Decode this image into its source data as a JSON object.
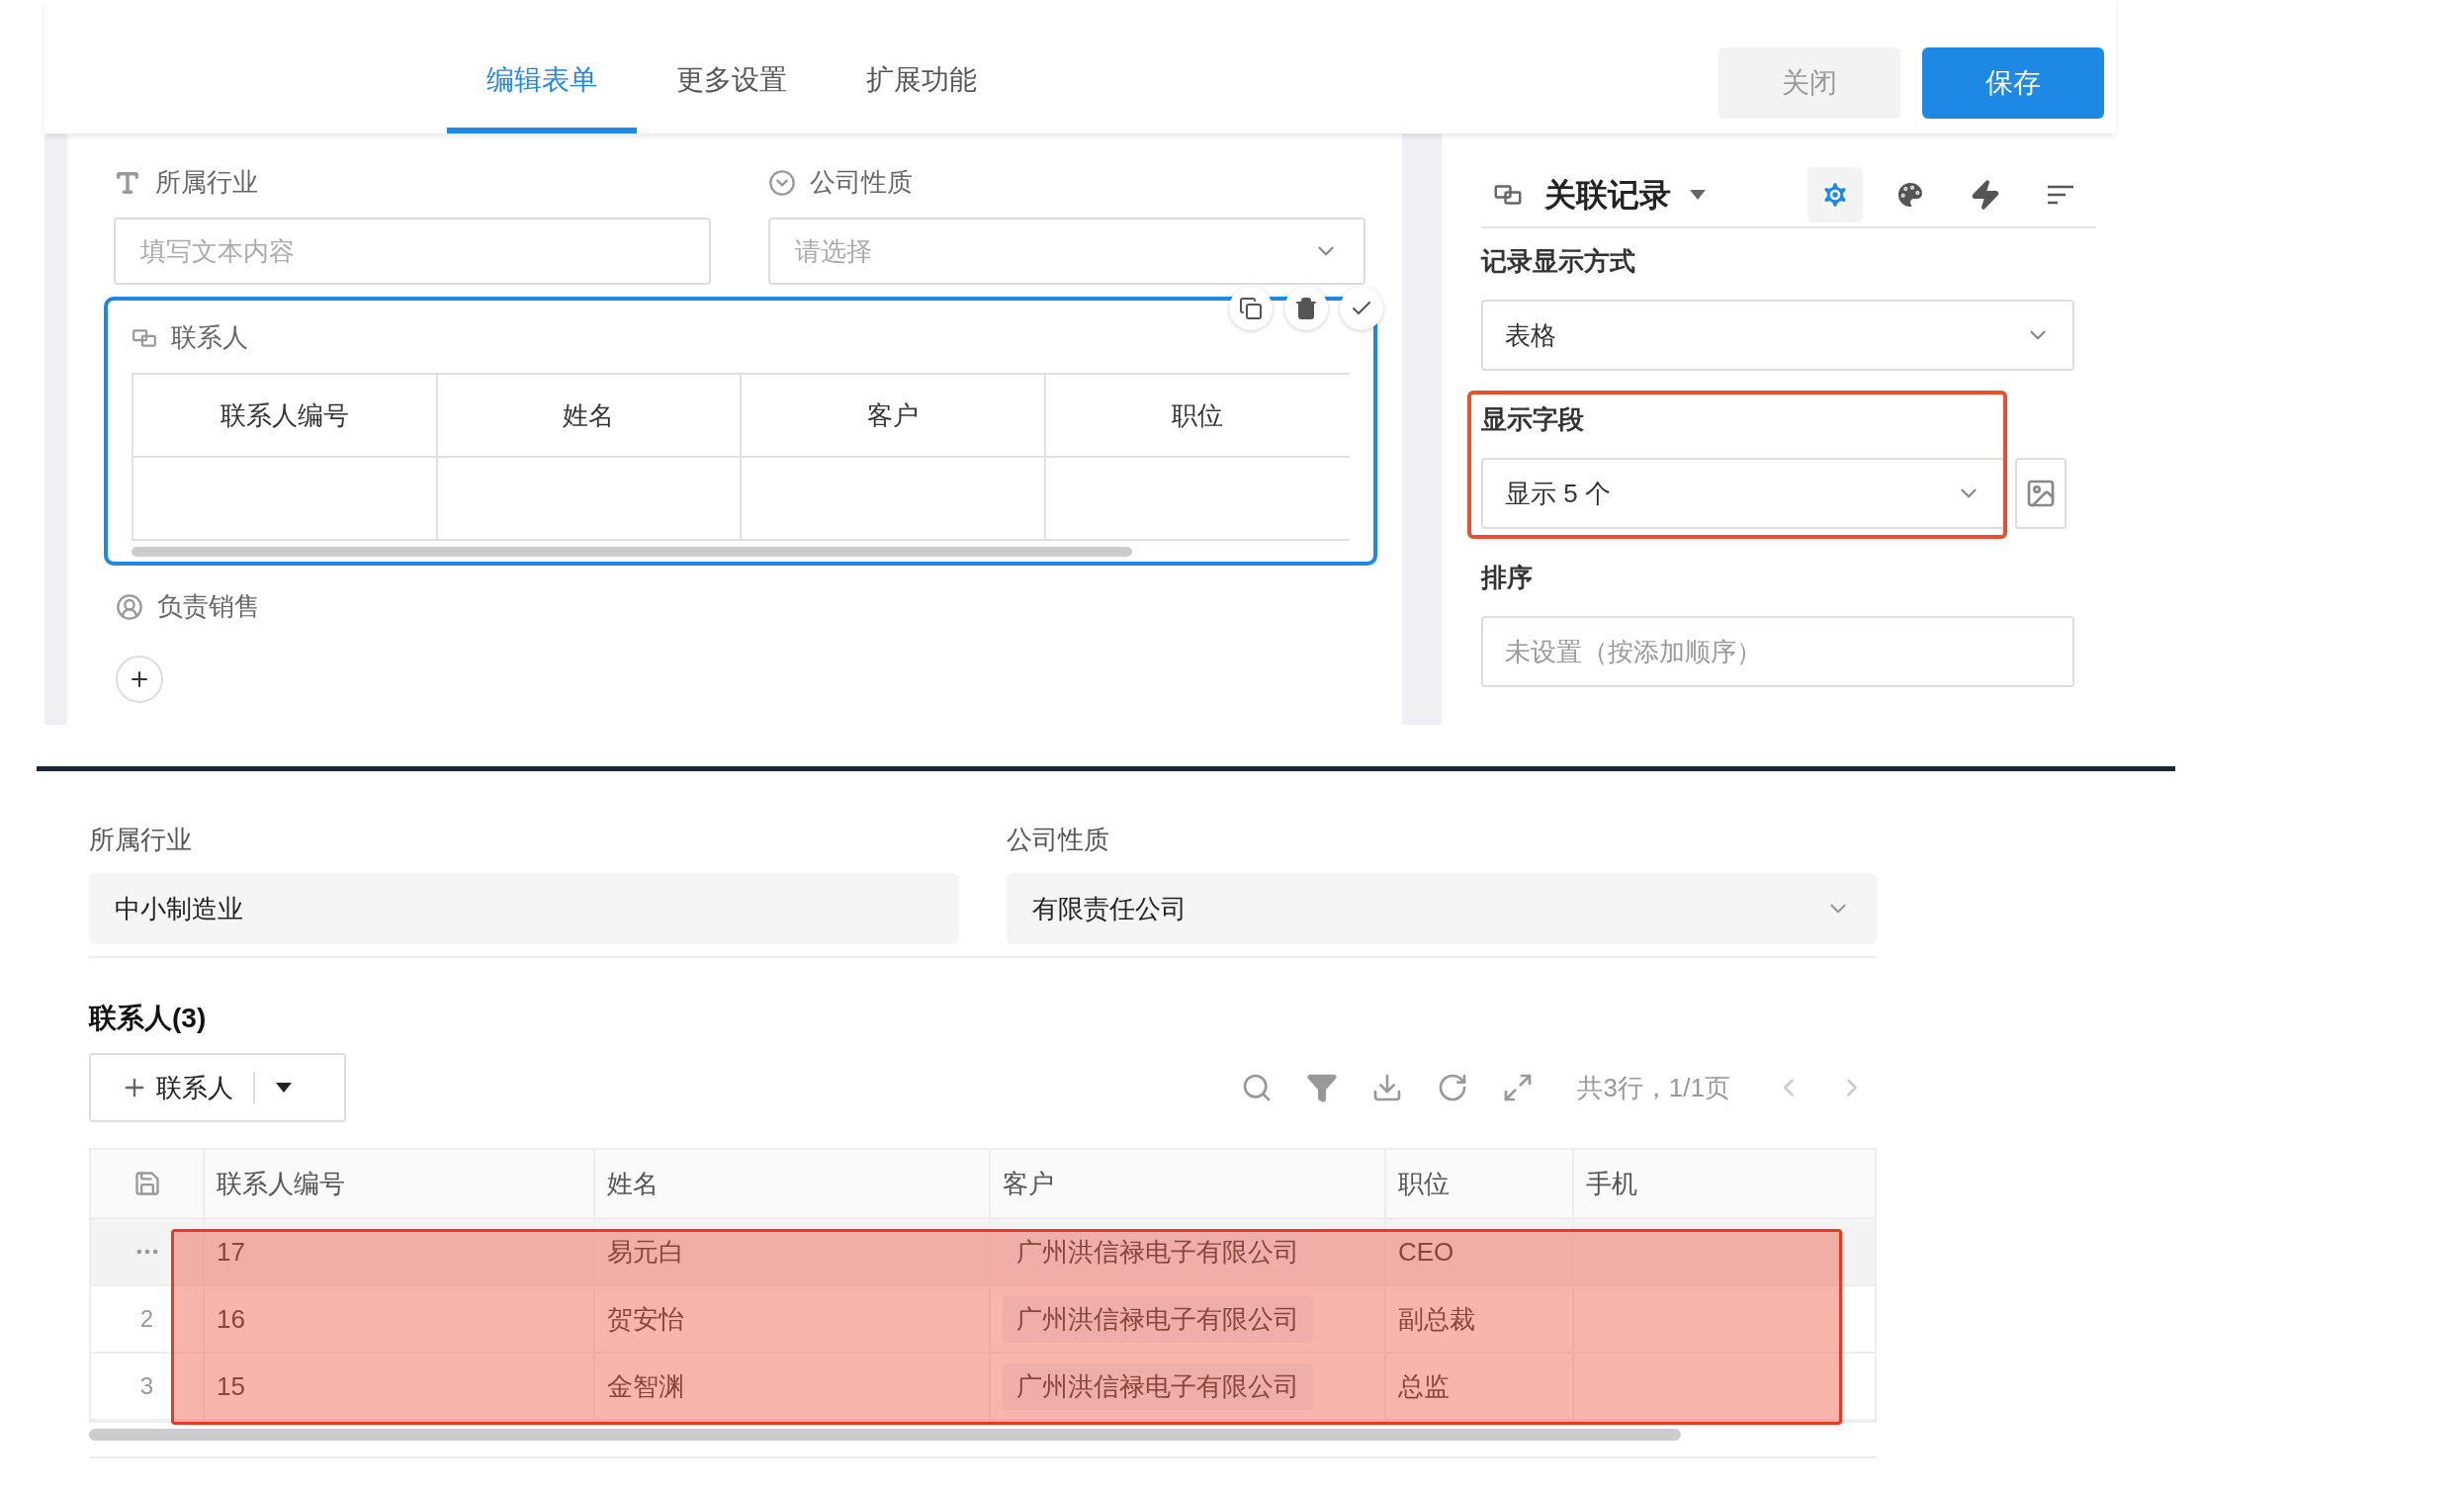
{
  "tabs": [
    {
      "label": "编辑表单",
      "selected": true
    },
    {
      "label": "更多设置",
      "selected": false
    },
    {
      "label": "扩展功能",
      "selected": false
    }
  ],
  "header_buttons": [
    {
      "label": "关闭",
      "kind": "secondary"
    },
    {
      "label": "保存",
      "kind": "primary"
    }
  ],
  "form_canvas": {
    "fields": [
      {
        "kind": "text",
        "label": "所属行业",
        "placeholder": "填写文本内容"
      },
      {
        "kind": "select",
        "label": "公司性质",
        "placeholder": "请选择"
      }
    ],
    "relation_field": {
      "label": "联系人",
      "selected": true,
      "columns": [
        "联系人编号",
        "姓名",
        "客户",
        "职位"
      ]
    },
    "user_field": {
      "label": "负责销售"
    }
  },
  "settings_panel": {
    "title": "关联记录",
    "tools": [
      {
        "kind": "settings",
        "selected": true
      },
      {
        "kind": "style",
        "selected": false
      },
      {
        "kind": "action",
        "selected": false
      },
      {
        "kind": "sort",
        "selected": false
      }
    ],
    "sections": [
      {
        "kind": "select",
        "label": "记录显示方式",
        "value": "表格"
      },
      {
        "kind": "select_image",
        "label": "显示字段",
        "value": "显示 5 个",
        "highlighted": true
      },
      {
        "kind": "text",
        "label": "排序",
        "placeholder": "未设置（按添加顺序）"
      }
    ]
  },
  "preview": {
    "fields": [
      {
        "kind": "text",
        "label": "所属行业",
        "value": "中小制造业"
      },
      {
        "kind": "select",
        "label": "公司性质",
        "value": "有限责任公司"
      }
    ],
    "section_title": "联系人(3)",
    "add_button": "联系人",
    "pager": "共3行，1/1页",
    "table": {
      "columns": [
        "联系人编号",
        "姓名",
        "客户",
        "职位",
        "手机"
      ],
      "highlighted": true,
      "rows": [
        {
          "hovered": true,
          "cells": [
            "17",
            "易元白",
            "广州洪信禄电子有限公司",
            "CEO"
          ]
        },
        {
          "hovered": false,
          "index": "2",
          "cells": [
            "16",
            "贺安怡",
            "广州洪信禄电子有限公司",
            "副总裁"
          ]
        },
        {
          "hovered": false,
          "index": "3",
          "cells": [
            "15",
            "金智渊",
            "广州洪信禄电子有限公司",
            "总监"
          ]
        }
      ]
    }
  }
}
